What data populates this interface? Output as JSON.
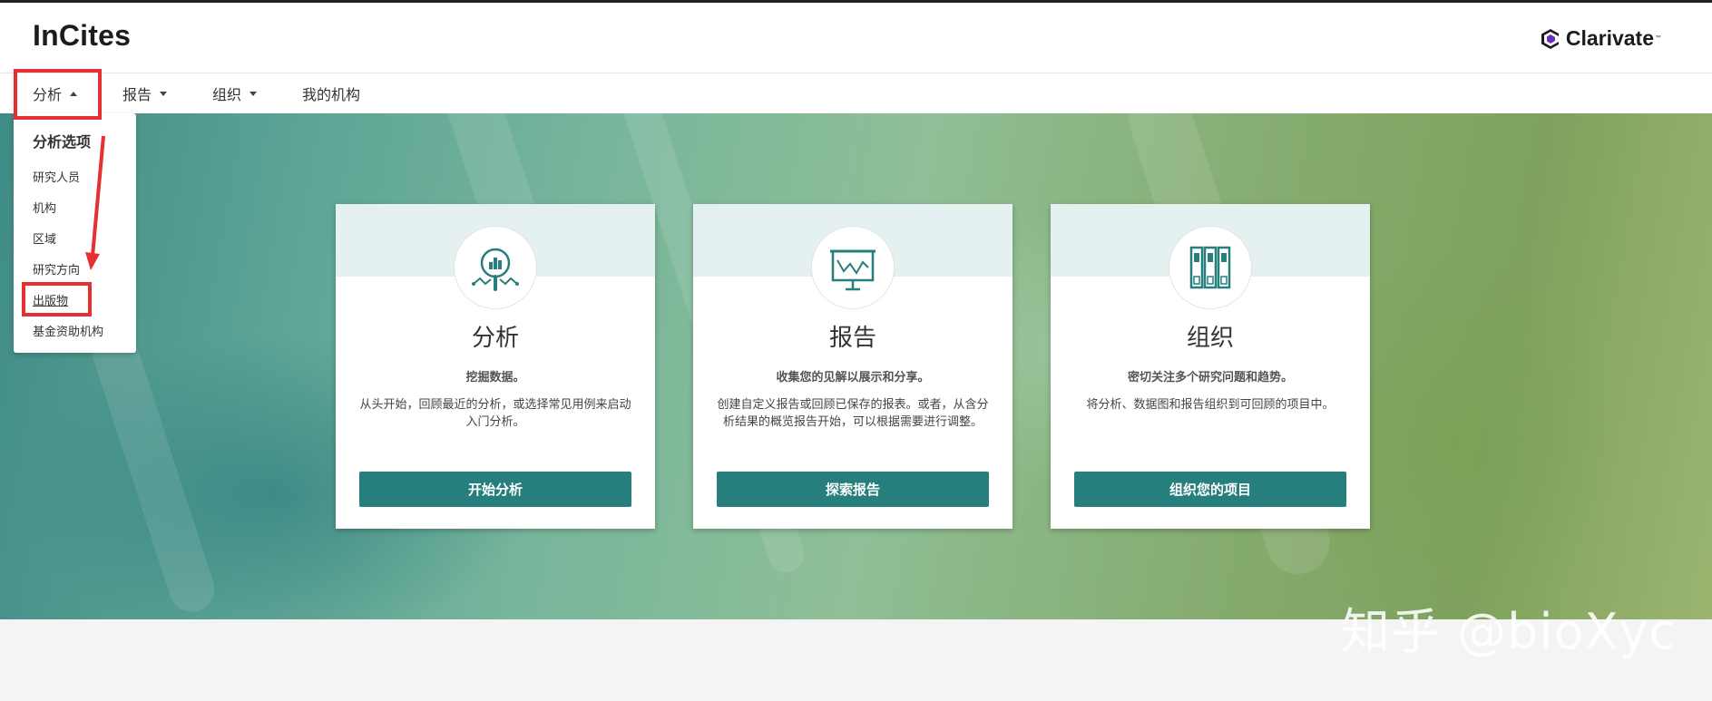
{
  "header": {
    "app_title": "InCites",
    "brand_name": "Clarivate",
    "brand_tm": "™"
  },
  "nav": {
    "items": [
      {
        "label": "分析",
        "state": "expanded"
      },
      {
        "label": "报告",
        "state": "collapsed"
      },
      {
        "label": "组织",
        "state": "collapsed"
      },
      {
        "label": "我的机构",
        "state": "none"
      }
    ]
  },
  "dropdown": {
    "header": "分析选项",
    "items": [
      {
        "label": "研究人员"
      },
      {
        "label": "机构"
      },
      {
        "label": "区域"
      },
      {
        "label": "研究方向"
      },
      {
        "label": "出版物",
        "highlighted": true
      },
      {
        "label": "基金资助机构"
      }
    ]
  },
  "cards": [
    {
      "icon": "magnifier-chart-icon",
      "title": "分析",
      "tagline": "挖掘数据。",
      "description": "从头开始，回顾最近的分析，或选择常见用例来启动入门分析。",
      "button": "开始分析"
    },
    {
      "icon": "presentation-board-icon",
      "title": "报告",
      "tagline": "收集您的见解以展示和分享。",
      "description": "创建自定义报告或回顾已保存的报表。或者，从含分析结果的概览报告开始，可以根据需要进行调整。",
      "button": "探索报告"
    },
    {
      "icon": "binders-icon",
      "title": "组织",
      "tagline": "密切关注多个研究问题和趋势。",
      "description": "将分析、数据图和报告组织到可回顾的项目中。",
      "button": "组织您的项目"
    }
  ],
  "watermark": "知乎 @bioXyc",
  "colors": {
    "accent": "#277f7d",
    "highlight": "#e4312f",
    "card_band": "#e5f1f0"
  }
}
